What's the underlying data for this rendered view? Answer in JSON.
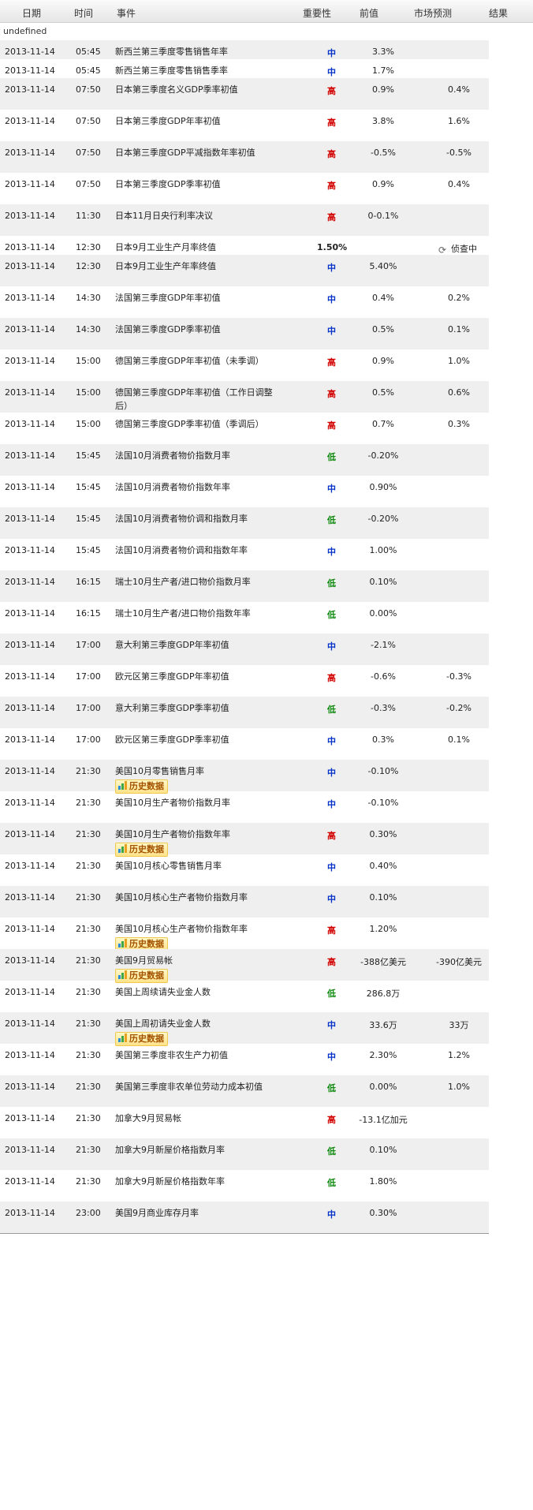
{
  "header": {
    "date": "日期",
    "time": "时间",
    "event": "事件",
    "importance": "重要性",
    "previous": "前值",
    "forecast": "市场预测",
    "result": "结果"
  },
  "undefined_label": "undefined",
  "hist_label": "历史数据",
  "pending_label": "侦查中",
  "rows": [
    {
      "date": "2013-11-14",
      "time": "05:45",
      "event": "新西兰第三季度零售销售年率",
      "imp": "中",
      "prev": "3.3%",
      "fc": "",
      "h": 24,
      "shade": true
    },
    {
      "date": "2013-11-14",
      "time": "05:45",
      "event": "新西兰第三季度零售销售季率",
      "imp": "中",
      "prev": "1.7%",
      "fc": "",
      "h": 24,
      "shade": false
    },
    {
      "date": "2013-11-14",
      "time": "07:50",
      "event": "日本第三季度名义GDP季率初值",
      "imp": "高",
      "prev": "0.9%",
      "fc": "0.4%",
      "h": 40,
      "shade": true
    },
    {
      "date": "2013-11-14",
      "time": "07:50",
      "event": "日本第三季度GDP年率初值",
      "imp": "高",
      "prev": "3.8%",
      "fc": "1.6%",
      "h": 40,
      "shade": false
    },
    {
      "date": "2013-11-14",
      "time": "07:50",
      "event": "日本第三季度GDP平减指数年率初值",
      "imp": "高",
      "prev": "-0.5%",
      "fc": "-0.5%",
      "h": 40,
      "shade": true
    },
    {
      "date": "2013-11-14",
      "time": "07:50",
      "event": "日本第三季度GDP季率初值",
      "imp": "高",
      "prev": "0.9%",
      "fc": "0.4%",
      "h": 40,
      "shade": false
    },
    {
      "date": "2013-11-14",
      "time": "11:30",
      "event": "日本11月日央行利率决议",
      "imp": "高",
      "prev": "0-0.1%",
      "fc": "",
      "h": 40,
      "shade": true
    },
    {
      "date": "2013-11-14",
      "time": "12:30",
      "event": "日本9月工业生产月率终值",
      "imp": "1.50%",
      "plain": true,
      "prev": "",
      "fc": "",
      "pending": true,
      "h": 24,
      "shade": false
    },
    {
      "date": "2013-11-14",
      "time": "12:30",
      "event": "日本9月工业生产年率终值",
      "imp": "中",
      "prev": "5.40%",
      "fc": "",
      "h": 40,
      "shade": true
    },
    {
      "date": "2013-11-14",
      "time": "14:30",
      "event": "法国第三季度GDP年率初值",
      "imp": "中",
      "prev": "0.4%",
      "fc": "0.2%",
      "h": 40,
      "shade": false
    },
    {
      "date": "2013-11-14",
      "time": "14:30",
      "event": "法国第三季度GDP季率初值",
      "imp": "中",
      "prev": "0.5%",
      "fc": "0.1%",
      "h": 40,
      "shade": true
    },
    {
      "date": "2013-11-14",
      "time": "15:00",
      "event": "德国第三季度GDP年率初值（未季调）",
      "imp": "高",
      "prev": "0.9%",
      "fc": "1.0%",
      "h": 40,
      "shade": false
    },
    {
      "date": "2013-11-14",
      "time": "15:00",
      "event": "德国第三季度GDP年率初值（工作日调整后）",
      "imp": "高",
      "prev": "0.5%",
      "fc": "0.6%",
      "h": 40,
      "shade": true
    },
    {
      "date": "2013-11-14",
      "time": "15:00",
      "event": "德国第三季度GDP季率初值（季调后）",
      "imp": "高",
      "prev": "0.7%",
      "fc": "0.3%",
      "h": 40,
      "shade": false
    },
    {
      "date": "2013-11-14",
      "time": "15:45",
      "event": "法国10月消费者物价指数月率",
      "imp": "低",
      "prev": "-0.20%",
      "fc": "",
      "h": 40,
      "shade": true
    },
    {
      "date": "2013-11-14",
      "time": "15:45",
      "event": "法国10月消费者物价指数年率",
      "imp": "中",
      "prev": "0.90%",
      "fc": "",
      "h": 40,
      "shade": false
    },
    {
      "date": "2013-11-14",
      "time": "15:45",
      "event": "法国10月消费者物价调和指数月率",
      "imp": "低",
      "prev": "-0.20%",
      "fc": "",
      "h": 40,
      "shade": true
    },
    {
      "date": "2013-11-14",
      "time": "15:45",
      "event": "法国10月消费者物价调和指数年率",
      "imp": "中",
      "prev": "1.00%",
      "fc": "",
      "h": 40,
      "shade": false
    },
    {
      "date": "2013-11-14",
      "time": "16:15",
      "event": "瑞士10月生产者/进口物价指数月率",
      "imp": "低",
      "prev": "0.10%",
      "fc": "",
      "h": 40,
      "shade": true
    },
    {
      "date": "2013-11-14",
      "time": "16:15",
      "event": "瑞士10月生产者/进口物价指数年率",
      "imp": "低",
      "prev": "0.00%",
      "fc": "",
      "h": 40,
      "shade": false
    },
    {
      "date": "2013-11-14",
      "time": "17:00",
      "event": "意大利第三季度GDP年率初值",
      "imp": "中",
      "prev": "-2.1%",
      "fc": "",
      "h": 40,
      "shade": true
    },
    {
      "date": "2013-11-14",
      "time": "17:00",
      "event": "欧元区第三季度GDP年率初值",
      "imp": "高",
      "prev": "-0.6%",
      "fc": "-0.3%",
      "h": 40,
      "shade": false
    },
    {
      "date": "2013-11-14",
      "time": "17:00",
      "event": "意大利第三季度GDP季率初值",
      "imp": "低",
      "prev": "-0.3%",
      "fc": "-0.2%",
      "h": 40,
      "shade": true
    },
    {
      "date": "2013-11-14",
      "time": "17:00",
      "event": "欧元区第三季度GDP季率初值",
      "imp": "中",
      "prev": "0.3%",
      "fc": "0.1%",
      "h": 40,
      "shade": false
    },
    {
      "date": "2013-11-14",
      "time": "21:30",
      "event": "美国10月零售销售月率",
      "imp": "中",
      "prev": "-0.10%",
      "fc": "",
      "hist": true,
      "h": 40,
      "shade": true
    },
    {
      "date": "2013-11-14",
      "time": "21:30",
      "event": "美国10月生产者物价指数月率",
      "imp": "中",
      "prev": "-0.10%",
      "fc": "",
      "h": 40,
      "shade": false
    },
    {
      "date": "2013-11-14",
      "time": "21:30",
      "event": "美国10月生产者物价指数年率",
      "imp": "高",
      "prev": "0.30%",
      "fc": "",
      "hist": true,
      "h": 40,
      "shade": true
    },
    {
      "date": "2013-11-14",
      "time": "21:30",
      "event": "美国10月核心零售销售月率",
      "imp": "中",
      "prev": "0.40%",
      "fc": "",
      "h": 40,
      "shade": false
    },
    {
      "date": "2013-11-14",
      "time": "21:30",
      "event": "美国10月核心生产者物价指数月率",
      "imp": "中",
      "prev": "0.10%",
      "fc": "",
      "h": 40,
      "shade": true
    },
    {
      "date": "2013-11-14",
      "time": "21:30",
      "event": "美国10月核心生产者物价指数年率",
      "imp": "高",
      "prev": "1.20%",
      "fc": "",
      "hist": true,
      "h": 40,
      "shade": false
    },
    {
      "date": "2013-11-14",
      "time": "21:30",
      "event": "美国9月贸易帐",
      "imp": "高",
      "prev": "-388亿美元",
      "fc": "-390亿美元",
      "hist": true,
      "h": 40,
      "shade": true
    },
    {
      "date": "2013-11-14",
      "time": "21:30",
      "event": "美国上周续请失业金人数",
      "imp": "低",
      "prev": "286.8万",
      "fc": "",
      "h": 40,
      "shade": false
    },
    {
      "date": "2013-11-14",
      "time": "21:30",
      "event": "美国上周初请失业金人数",
      "imp": "中",
      "prev": "33.6万",
      "fc": "33万",
      "hist": true,
      "h": 40,
      "shade": true
    },
    {
      "date": "2013-11-14",
      "time": "21:30",
      "event": "美国第三季度非农生产力初值",
      "imp": "中",
      "prev": "2.30%",
      "fc": "1.2%",
      "h": 40,
      "shade": false
    },
    {
      "date": "2013-11-14",
      "time": "21:30",
      "event": "美国第三季度非农单位劳动力成本初值",
      "imp": "低",
      "prev": "0.00%",
      "fc": "1.0%",
      "h": 40,
      "shade": true
    },
    {
      "date": "2013-11-14",
      "time": "21:30",
      "event": "加拿大9月贸易帐",
      "imp": "高",
      "prev": "-13.1亿加元",
      "fc": "",
      "h": 40,
      "shade": false
    },
    {
      "date": "2013-11-14",
      "time": "21:30",
      "event": "加拿大9月新屋价格指数月率",
      "imp": "低",
      "prev": "0.10%",
      "fc": "",
      "h": 40,
      "shade": true
    },
    {
      "date": "2013-11-14",
      "time": "21:30",
      "event": "加拿大9月新屋价格指数年率",
      "imp": "低",
      "prev": "1.80%",
      "fc": "",
      "h": 40,
      "shade": false
    },
    {
      "date": "2013-11-14",
      "time": "23:00",
      "event": "美国9月商业库存月率",
      "imp": "中",
      "prev": "0.30%",
      "fc": "",
      "h": 40,
      "shade": true
    }
  ]
}
